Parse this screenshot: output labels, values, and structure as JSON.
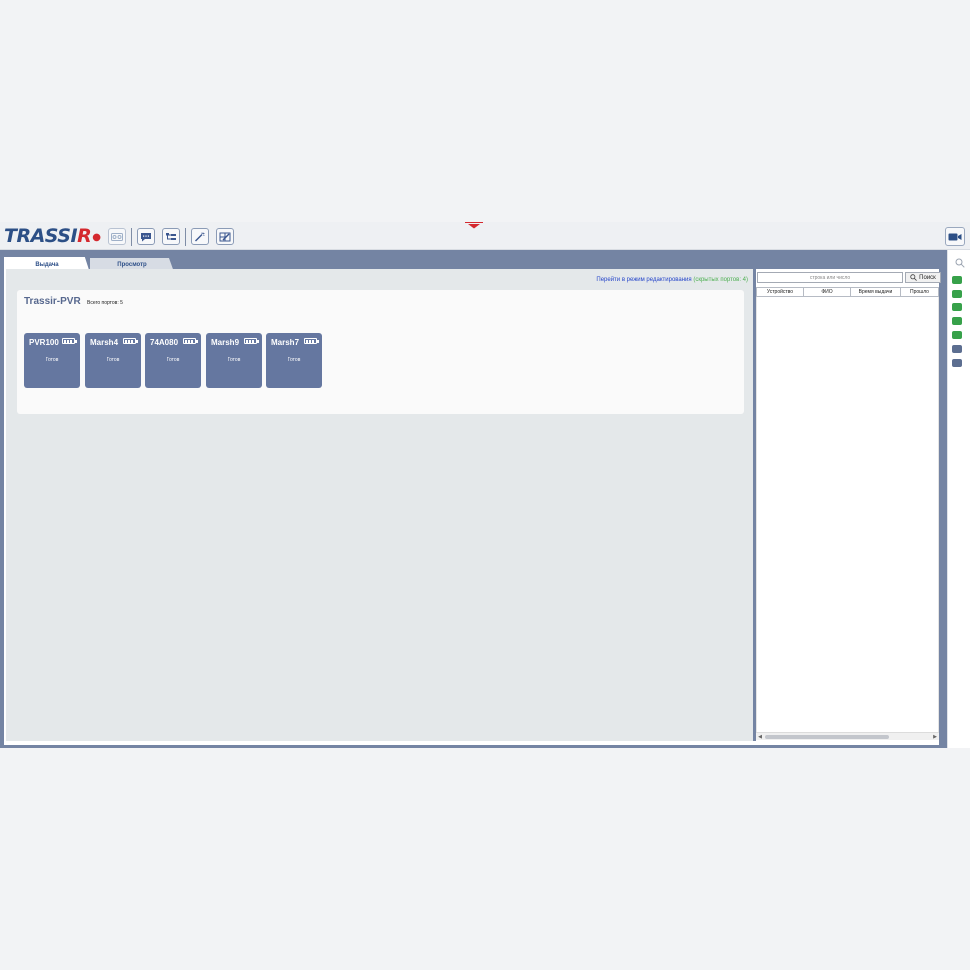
{
  "toolbar": {
    "logo_main": "TRASSI",
    "logo_r": "R",
    "logo_dot": "●"
  },
  "tabs": [
    {
      "label": "Выдача",
      "active": true
    },
    {
      "label": "Просмотр",
      "active": false
    }
  ],
  "main": {
    "edit_link": "Перейти в режим редактирования",
    "hidden_ports": "(скрытых портов: 4)",
    "group": {
      "title": "Trassir-PVR",
      "total_ports": "Всего портов: 5"
    },
    "ports": [
      {
        "name": "PVR100",
        "status": "Готов"
      },
      {
        "name": "Marsh4",
        "status": "Готов"
      },
      {
        "name": "74A080",
        "status": "Готов"
      },
      {
        "name": "Marsh9",
        "status": "Готов"
      },
      {
        "name": "Marsh7",
        "status": "Готов"
      }
    ]
  },
  "log": {
    "search_placeholder": "строка или число",
    "search_button": "Поиск",
    "columns": [
      "Устройство",
      "ФИО",
      "Время выдачи",
      "Прошло"
    ]
  },
  "colors": {
    "accent": "#2c4f86",
    "logo_red": "#d4282e",
    "port_tile": "#6577a0",
    "frame": "#7484a3",
    "status_green": "#37a14a"
  }
}
